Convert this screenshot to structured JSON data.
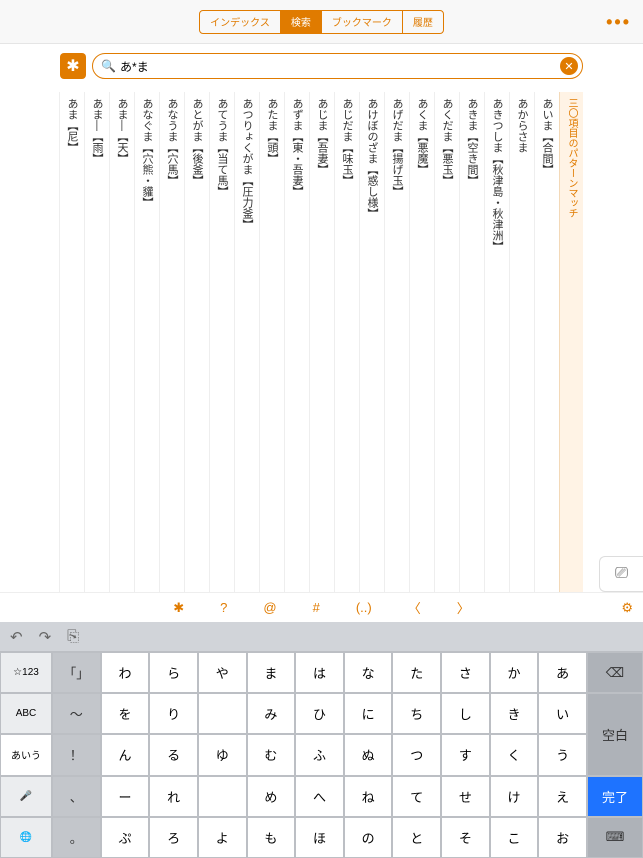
{
  "nav": {
    "tabs": [
      "インデックス",
      "検索",
      "ブックマーク",
      "履歴"
    ],
    "activeIndex": 1
  },
  "search": {
    "query": "あ*ま",
    "patternGlyph": "✱"
  },
  "resultsHeader": "三〇項目のパターンマッチ",
  "results": [
    "あいま【合間】",
    "あからさま",
    "あきつしま【秋津島・秋津洲】",
    "あきま【空き間】",
    "あくだま【悪玉】",
    "あくま【悪魔】",
    "あげだま【揚げ玉】",
    "あけぼのざま【惑し様】",
    "あじだま【味玉】",
    "あじま【吾妻】",
    "あずま【東・吾妻】",
    "あたま【頭】",
    "あつりょくがま【圧力釜】",
    "あてうま【当て馬】",
    "あとがま【後釜】",
    "あなうま【穴馬】",
    "あなぐま【穴熊・貛】",
    "あま―【天】",
    "あま―【雨】",
    "あま【尼】"
  ],
  "symbols": [
    "✱",
    "?",
    "@",
    "#",
    "(..)",
    "〈",
    "〉"
  ],
  "keyboard": {
    "topIcons": [
      "↶",
      "↷",
      "⎘"
    ],
    "modeKeys": [
      "☆123",
      "ABC",
      "あいう"
    ],
    "bottomMode": [
      "🎤",
      "🌐"
    ],
    "leftCol": [
      "「」",
      "〜",
      "！",
      "、",
      "。"
    ],
    "grid": [
      [
        "わ",
        "ら",
        "や",
        "ま",
        "は",
        "な",
        "た",
        "さ",
        "か",
        "あ"
      ],
      [
        "を",
        "り",
        "",
        "み",
        "ひ",
        "に",
        "ち",
        "し",
        "き",
        "い"
      ],
      [
        "ん",
        "る",
        "ゆ",
        "む",
        "ふ",
        "ぬ",
        "つ",
        "す",
        "く",
        "う"
      ],
      [
        "ー",
        "れ",
        "",
        "め",
        "へ",
        "ね",
        "て",
        "せ",
        "け",
        "え"
      ],
      [
        "゜",
        "ろ",
        "よ",
        "も",
        "ほ",
        "の",
        "と",
        "そ",
        "こ",
        "お"
      ]
    ],
    "smallChar": "ぷ",
    "actions": {
      "delete": "⌫",
      "space": "空白",
      "done": "完了",
      "dismiss": "⌨"
    }
  }
}
